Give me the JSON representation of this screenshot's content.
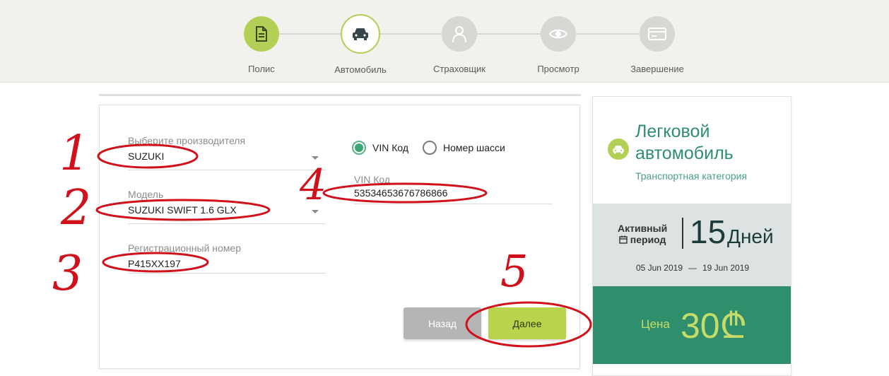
{
  "steps": [
    {
      "label": "Полис",
      "icon": "document-icon",
      "state": "done"
    },
    {
      "label": "Автомобиль",
      "icon": "car-icon",
      "state": "active"
    },
    {
      "label": "Страховщик",
      "icon": "person-icon",
      "state": "pending"
    },
    {
      "label": "Просмотр",
      "icon": "eye-icon",
      "state": "pending"
    },
    {
      "label": "Завершение",
      "icon": "card-icon",
      "state": "pending"
    }
  ],
  "form": {
    "manufacturer": {
      "label": "Выберите производителя",
      "value": "SUZUKI"
    },
    "model": {
      "label": "Модель",
      "value": "SUZUKI SWIFT 1.6 GLX"
    },
    "registration": {
      "label": "Регистрационный номер",
      "value": "P415XX197"
    },
    "id_type": {
      "options": [
        {
          "label": "VIN Код",
          "checked": true
        },
        {
          "label": "Номер шасси",
          "checked": false
        }
      ]
    },
    "vin": {
      "label": "VIN Код",
      "value": "53534653676786866"
    },
    "back_label": "Назад",
    "next_label": "Далее"
  },
  "annotations": [
    "1",
    "2",
    "3",
    "4",
    "5"
  ],
  "summary": {
    "title": "Легковой автомобиль",
    "subtitle": "Транспортная категория",
    "period_label_1": "Активный",
    "period_label_2": "период",
    "period_value": "15",
    "period_unit": "Дней",
    "date_from": "05 Jun 2019",
    "date_sep": "—",
    "date_to": "19 Jun 2019",
    "price_label": "Цена",
    "price_value": "30₾"
  },
  "colors": {
    "accent_green": "#b4cf55",
    "brand_green": "#2f8e6b",
    "annotation_red": "#d0101a"
  }
}
